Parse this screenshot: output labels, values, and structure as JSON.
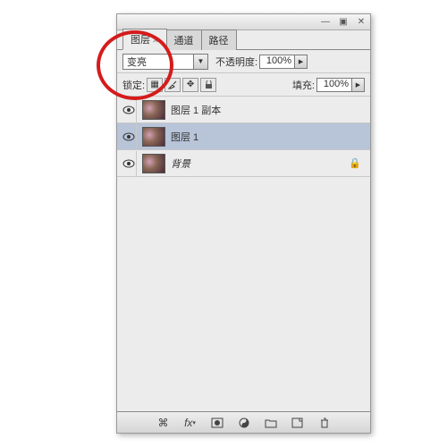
{
  "tabs": [
    {
      "label": "图层",
      "active": true
    },
    {
      "label": "通道",
      "active": false
    },
    {
      "label": "路径",
      "active": false
    }
  ],
  "blend_mode": "变亮",
  "opacity": {
    "label": "不透明度:",
    "value": "100%"
  },
  "lock": {
    "label": "锁定:"
  },
  "fill": {
    "label": "填充:",
    "value": "100%"
  },
  "layers": [
    {
      "name": "图层 1 副本",
      "visible": true,
      "selected": false,
      "locked": false,
      "italic": false
    },
    {
      "name": "图层 1",
      "visible": true,
      "selected": true,
      "locked": false,
      "italic": false
    },
    {
      "name": "背景",
      "visible": true,
      "selected": false,
      "locked": true,
      "italic": true
    }
  ]
}
